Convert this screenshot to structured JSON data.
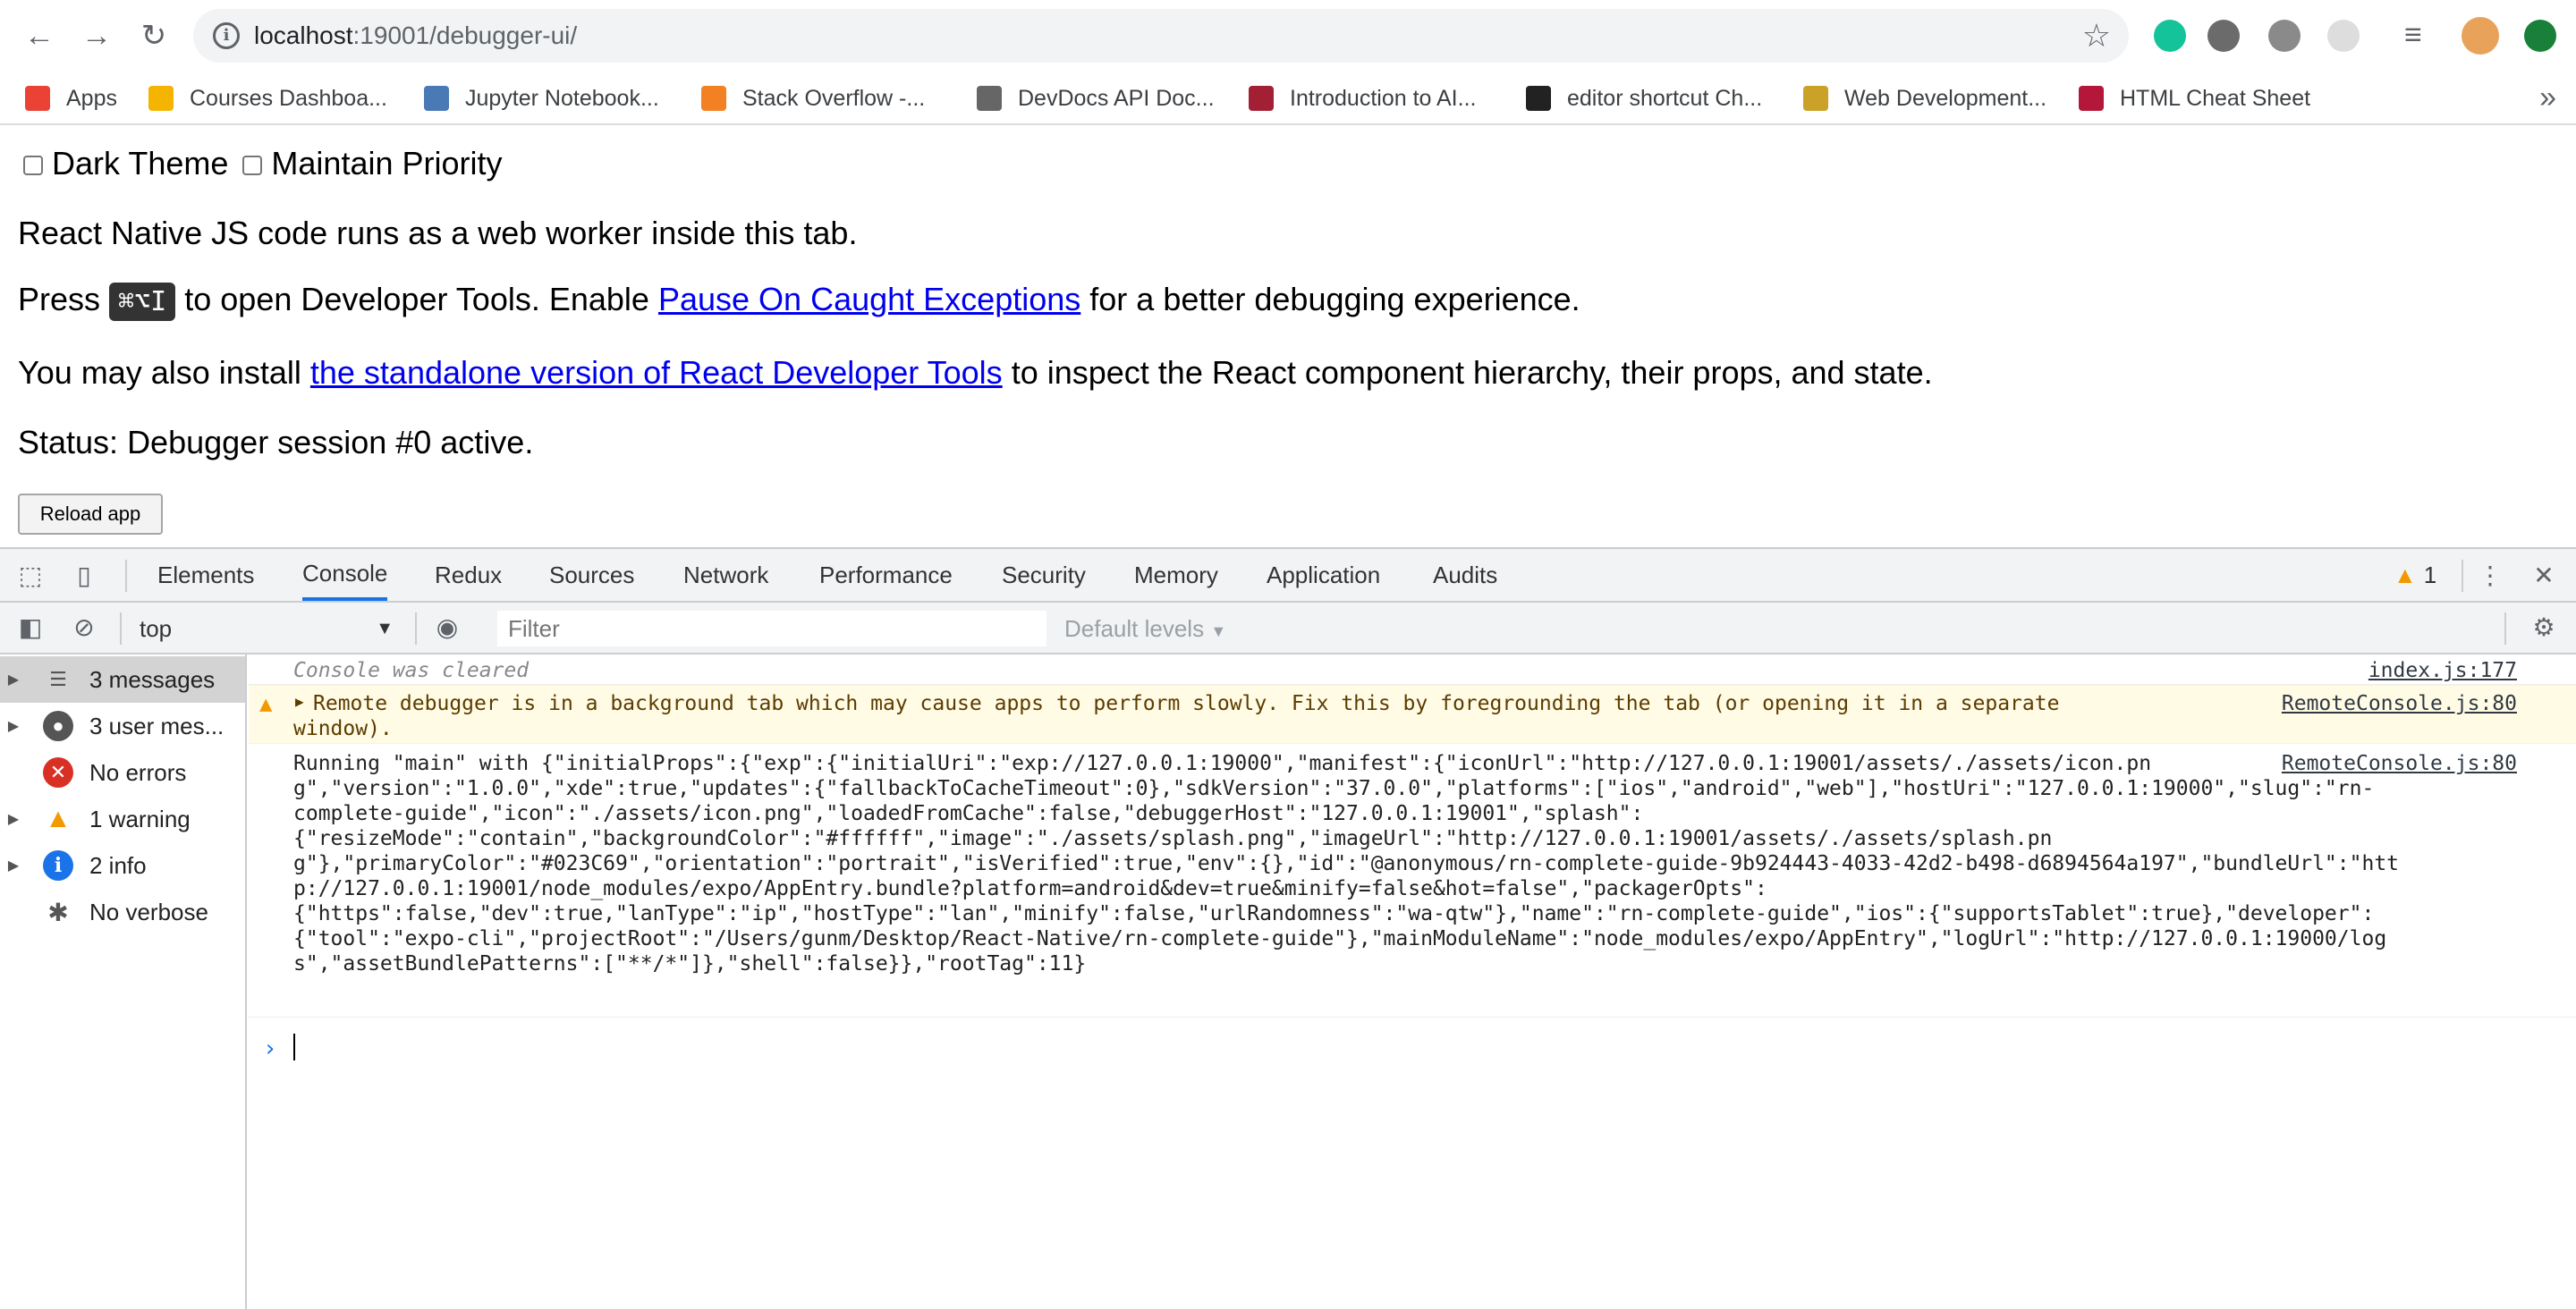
{
  "browser": {
    "url_host": "localhost",
    "url_rest": ":19001/debugger-ui/",
    "bookmarks": [
      {
        "label": "Apps",
        "color": "#ea4335"
      },
      {
        "label": "Courses Dashboa...",
        "color": "#f4b400"
      },
      {
        "label": "Jupyter Notebook...",
        "color": "#4a7ab5"
      },
      {
        "label": "Stack Overflow -...",
        "color": "#f48024"
      },
      {
        "label": "DevDocs API Doc...",
        "color": "#666666"
      },
      {
        "label": "Introduction to AI...",
        "color": "#a31f34"
      },
      {
        "label": "editor shortcut Ch...",
        "color": "#222222"
      },
      {
        "label": "Web Development...",
        "color": "#c9a227"
      },
      {
        "label": "HTML Cheat Sheet",
        "color": "#b5173a"
      }
    ]
  },
  "page": {
    "dark_theme": "Dark Theme",
    "maintain_priority": "Maintain Priority",
    "line1": "React Native JS code runs as a web worker inside this tab.",
    "press": "Press",
    "shortcut": "⌘⌥I",
    "open_devtools": "to open Developer Tools. Enable",
    "pause_link": "Pause On Caught Exceptions",
    "better": "for a better debugging experience.",
    "install_pre": "You may also install",
    "install_link": "the standalone version of React Developer Tools",
    "install_post": "to inspect the React component hierarchy, their props, and state.",
    "status": "Status: Debugger session #0 active.",
    "reload_button": "Reload app"
  },
  "devtools": {
    "tabs": [
      "Elements",
      "Console",
      "Redux",
      "Sources",
      "Network",
      "Performance",
      "Security",
      "Memory",
      "Application",
      "Audits"
    ],
    "active_tab": "Console",
    "warning_count": "1",
    "context": "top",
    "filter_placeholder": "Filter",
    "levels": "Default levels",
    "sidebar": [
      {
        "label": "3 messages",
        "icon": "list-icon"
      },
      {
        "label": "3 user mes...",
        "icon": "user-icon"
      },
      {
        "label": "No errors",
        "icon": "error-icon"
      },
      {
        "label": "1 warning",
        "icon": "warning-icon"
      },
      {
        "label": "2 info",
        "icon": "info-icon"
      },
      {
        "label": "No verbose",
        "icon": "bug-icon"
      }
    ],
    "messages": {
      "cleared": "Console was cleared",
      "cleared_src": "index.js:177",
      "warn_line1": "Remote debugger is in a background tab which may cause apps to perform slowly. Fix this by foregrounding the tab (or opening it in a separate",
      "warn_line2": "window).",
      "warn_src": "RemoteConsole.js:80",
      "log_src": "RemoteConsole.js:80",
      "log_lines": [
        "Running \"main\" with {\"initialProps\":{\"exp\":{\"initialUri\":\"exp://127.0.0.1:19000\",\"manifest\":{\"iconUrl\":\"http://127.0.0.1:19001/assets/./assets/icon.pn",
        "g\",\"version\":\"1.0.0\",\"xde\":true,\"updates\":{\"fallbackToCacheTimeout\":0},\"sdkVersion\":\"37.0.0\",\"platforms\":[\"ios\",\"android\",\"web\"],\"hostUri\":\"127.0.0.1:19000\",\"slug\":\"rn-",
        "complete-guide\",\"icon\":\"./assets/icon.png\",\"loadedFromCache\":false,\"debuggerHost\":\"127.0.0.1:19001\",\"splash\":",
        "{\"resizeMode\":\"contain\",\"backgroundColor\":\"#ffffff\",\"image\":\"./assets/splash.png\",\"imageUrl\":\"http://127.0.0.1:19001/assets/./assets/splash.pn",
        "g\"},\"primaryColor\":\"#023C69\",\"orientation\":\"portrait\",\"isVerified\":true,\"env\":{},\"id\":\"@anonymous/rn-complete-guide-9b924443-4033-42d2-b498-d6894564a197\",\"bundleUrl\":\"htt",
        "p://127.0.0.1:19001/node_modules/expo/AppEntry.bundle?platform=android&dev=true&minify=false&hot=false\",\"packagerOpts\":",
        "{\"https\":false,\"dev\":true,\"lanType\":\"ip\",\"hostType\":\"lan\",\"minify\":false,\"urlRandomness\":\"wa-qtw\"},\"name\":\"rn-complete-guide\",\"ios\":{\"supportsTablet\":true},\"developer\":",
        "{\"tool\":\"expo-cli\",\"projectRoot\":\"/Users/gunm/Desktop/React-Native/rn-complete-guide\"},\"mainModuleName\":\"node_modules/expo/AppEntry\",\"logUrl\":\"http://127.0.0.1:19000/log",
        "s\",\"assetBundlePatterns\":[\"**/*\"]},\"shell\":false}},\"rootTag\":11}"
      ]
    }
  }
}
